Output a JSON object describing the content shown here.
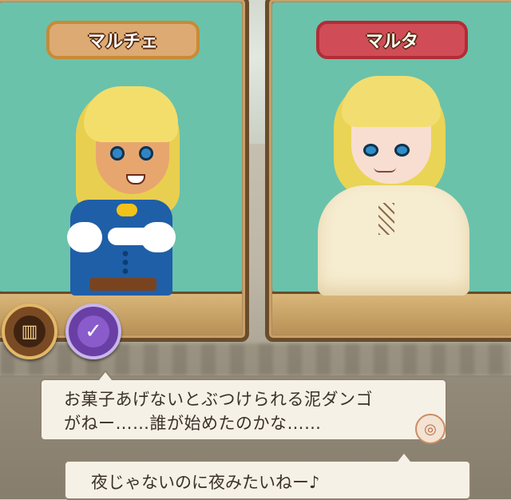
{
  "speakers": {
    "left": {
      "name": "マルチェ",
      "plate_color": "#dcaa72"
    },
    "right": {
      "name": "マルタ",
      "plate_color": "#d04d57"
    }
  },
  "icons": {
    "record": {
      "name": "record-book-icon",
      "glyph": "▥"
    },
    "check": {
      "name": "checkmark-icon",
      "glyph": "✓"
    },
    "next": {
      "name": "next-page-icon",
      "glyph": "◎"
    }
  },
  "dialogue": {
    "line1": "お菓子あげないとぶつけられる泥ダンゴ",
    "line2": "がねー……誰が始めたのかな……",
    "reply": "夜じゃないのに夜みたいねー♪"
  },
  "colors": {
    "screen_teal": "#6ac2ab",
    "frame_brown": "#6a4c2a",
    "bubble_bg": "#f6f1e6"
  }
}
